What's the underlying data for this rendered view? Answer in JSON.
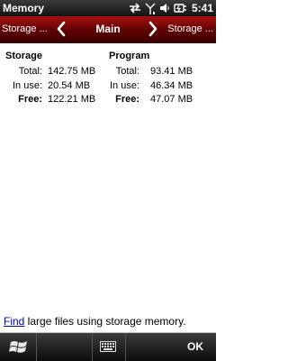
{
  "titlebar": {
    "title": "Memory",
    "time": "5:41"
  },
  "navbar": {
    "prev_label": "Storage ...",
    "main_label": "Main",
    "next_label": "Storage ..."
  },
  "storage": {
    "header": "Storage",
    "rows": [
      {
        "label": "Total:",
        "value": "142.75 MB"
      },
      {
        "label": "In use:",
        "value": "20.54 MB"
      },
      {
        "label": "Free:",
        "value": "122.21 MB"
      }
    ]
  },
  "program": {
    "header": "Program",
    "rows": [
      {
        "label": "Total:",
        "value": "93.41 MB"
      },
      {
        "label": "In use:",
        "value": "46.34 MB"
      },
      {
        "label": "Free:",
        "value": "47.07 MB"
      }
    ]
  },
  "footer": {
    "link_text": "Find",
    "rest_text": " large files using storage memory."
  },
  "softkeys": {
    "right": "OK"
  }
}
